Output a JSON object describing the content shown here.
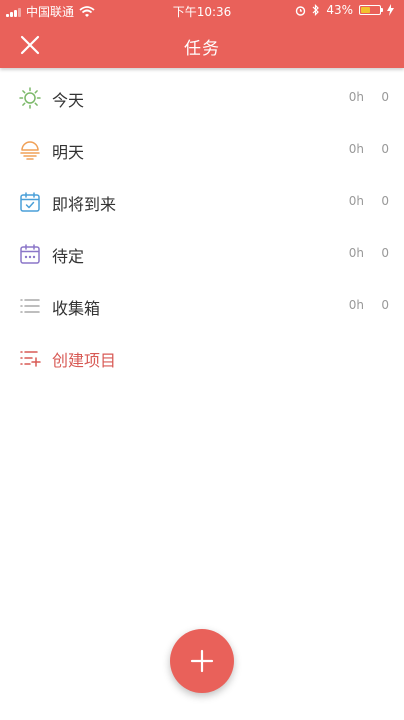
{
  "status_bar": {
    "carrier": "中国联通",
    "time": "下午10:36",
    "battery": "43%",
    "battery_level": 0.43
  },
  "header": {
    "title": "任务",
    "close_icon": "close-icon"
  },
  "tasks": [
    {
      "label": "今天",
      "hours": "0h",
      "count": "0",
      "icon": "sun-icon",
      "color": "#7cb96a"
    },
    {
      "label": "明天",
      "hours": "0h",
      "count": "0",
      "icon": "sunrise-icon",
      "color": "#f0a056"
    },
    {
      "label": "即将到来",
      "hours": "0h",
      "count": "0",
      "icon": "calendar-check-icon",
      "color": "#4a9fd8"
    },
    {
      "label": "待定",
      "hours": "0h",
      "count": "0",
      "icon": "calendar-dots-icon",
      "color": "#8b76c8"
    },
    {
      "label": "收集箱",
      "hours": "0h",
      "count": "0",
      "icon": "list-icon",
      "color": "#a8a8a8"
    }
  ],
  "create_project": {
    "label": "创建项目",
    "icon": "list-add-icon",
    "color": "#d85a55"
  },
  "fab": {
    "icon": "plus-icon"
  },
  "colors": {
    "accent": "#e9615a"
  }
}
